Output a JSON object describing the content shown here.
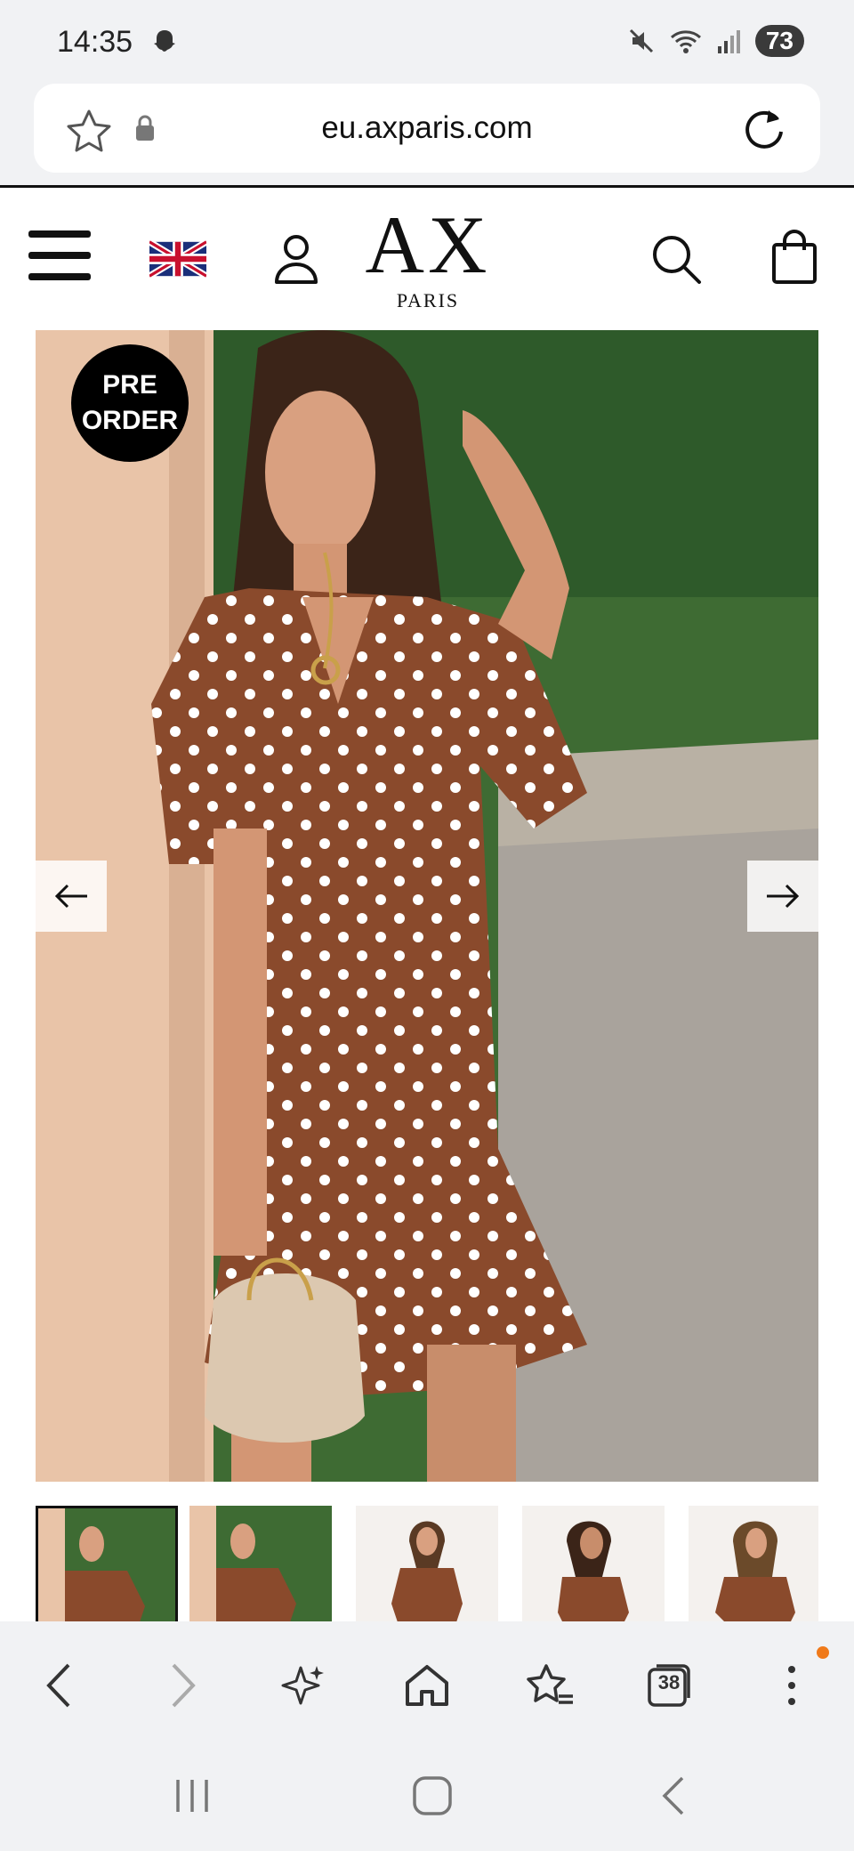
{
  "status_bar": {
    "time": "14:35",
    "battery": "73",
    "icons": [
      "snapchat-icon",
      "mute-icon",
      "wifi-icon",
      "signal-icon"
    ]
  },
  "browser": {
    "url": "eu.axparis.com",
    "tab_count": "38"
  },
  "site_header": {
    "logo_main": "AX",
    "logo_sub": "PARIS",
    "icons": [
      "menu-icon",
      "uk-flag-icon",
      "account-icon",
      "search-icon",
      "bag-icon"
    ]
  },
  "product": {
    "badge_line1": "PRE",
    "badge_line2": "ORDER",
    "thumbnail_count": 5,
    "active_thumbnail": 1
  },
  "colors": {
    "dress": "#8a4a2c",
    "accent": "#f07a1a"
  }
}
